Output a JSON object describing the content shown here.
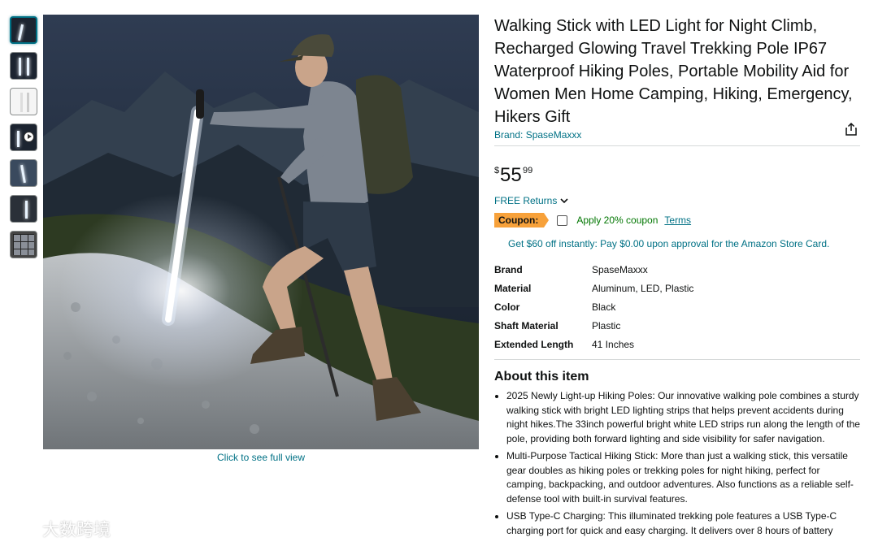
{
  "product": {
    "title": "Walking Stick with LED Light for Night Climb, Recharged Glowing Travel Trekking Pole IP67 Waterproof Hiking Poles, Portable Mobility Aid for Women Men Home Camping, Hiking, Emergency, Hikers Gift",
    "brand_link": "Brand: SpaseMaxxx",
    "price_symbol": "$",
    "price_whole": "55",
    "price_fraction": "99",
    "returns": "FREE Returns",
    "coupon_badge": "Coupon:",
    "coupon_text": "Apply 20% coupon",
    "coupon_terms": "Terms",
    "card_offer": "Get $60 off instantly: Pay $0.00 upon approval for the Amazon Store Card."
  },
  "gallery": {
    "full_view_link": "Click to see full view",
    "thumbnails": [
      "night-hiker",
      "poles-pair",
      "product-white",
      "video",
      "hiker-2",
      "hiker-3",
      "collage"
    ],
    "selected_index": 0
  },
  "specs": [
    {
      "key": "Brand",
      "value": "SpaseMaxxx"
    },
    {
      "key": "Material",
      "value": "Aluminum, LED, Plastic"
    },
    {
      "key": "Color",
      "value": "Black"
    },
    {
      "key": "Shaft Material",
      "value": "Plastic"
    },
    {
      "key": "Extended Length",
      "value": "41 Inches"
    }
  ],
  "about": {
    "heading": "About this item",
    "bullets": [
      "2025 Newly Light-up Hiking Poles: Our innovative walking pole combines a sturdy walking stick with bright LED lighting strips that helps prevent accidents during night hikes.The 33inch powerful bright white LED strips run along the length of the pole, providing both forward lighting and side visibility for safer navigation.",
      "Multi-Purpose Tactical Hiking Stick: More than just a walking stick, this versatile gear doubles as hiking poles or trekking poles for night hiking, perfect for camping, backpacking, and outdoor adventures. Also functions as a reliable self-defense tool with built-in survival features.",
      "USB Type-C Charging: This illuminated trekking pole features a USB Type-C charging port for quick and easy charging. It delivers over 8 hours of battery"
    ]
  },
  "watermark": "大数跨境",
  "colors": {
    "link": "#007185",
    "coupon_badge": "#f7a13a",
    "coupon_text": "#007600",
    "thumb_selected": "#007185"
  }
}
